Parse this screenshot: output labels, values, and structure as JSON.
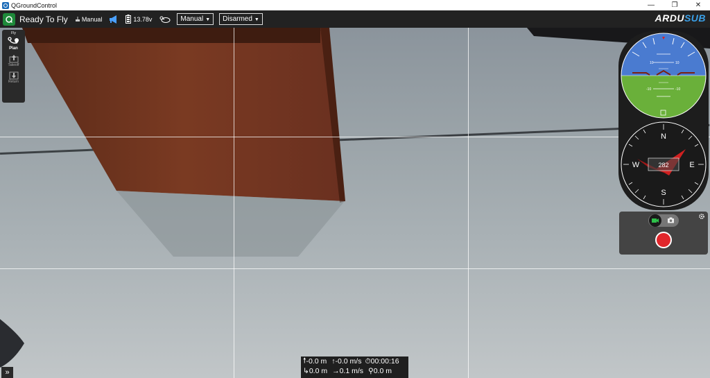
{
  "window": {
    "title": "QGroundControl",
    "controls": {
      "minimize": "—",
      "restore": "❐",
      "close": "✕"
    }
  },
  "toolbar": {
    "status": "Ready To Fly",
    "mode_indicator": "Manual",
    "battery_voltage": "13.78v",
    "flight_mode_dropdown": "Manual",
    "arm_dropdown": "Disarmed",
    "brand": {
      "left": "ARDU",
      "right": "SUB"
    },
    "colors": {
      "status_green": "#1e8a3a",
      "brand_blue": "#3aa0e8"
    }
  },
  "toolstrip": {
    "header": "Fly",
    "items": [
      {
        "label": "Plan",
        "icon": "plan-icon"
      },
      {
        "label": "Takeoff",
        "icon": "takeoff-icon"
      },
      {
        "label": "Return",
        "icon": "return-icon"
      }
    ]
  },
  "attitude": {
    "pitch_labels": [
      "10",
      "10",
      "-10",
      "-10"
    ]
  },
  "compass": {
    "heading": "282",
    "north": "N",
    "east": "E",
    "south": "S",
    "west": "W"
  },
  "camera": {
    "mode_icons": [
      "video-icon",
      "camera-icon"
    ],
    "record_color": "#e0262b"
  },
  "telemetry": {
    "row1": {
      "altitude": "-0.0 m",
      "vertical_speed": "-0.0 m/s",
      "flight_time": "00:00:16"
    },
    "row2": {
      "distance": "0.0 m",
      "horizontal_speed": "0.1 m/s",
      "home_distance": "0.0 m"
    }
  },
  "expand": {
    "label": "»"
  }
}
